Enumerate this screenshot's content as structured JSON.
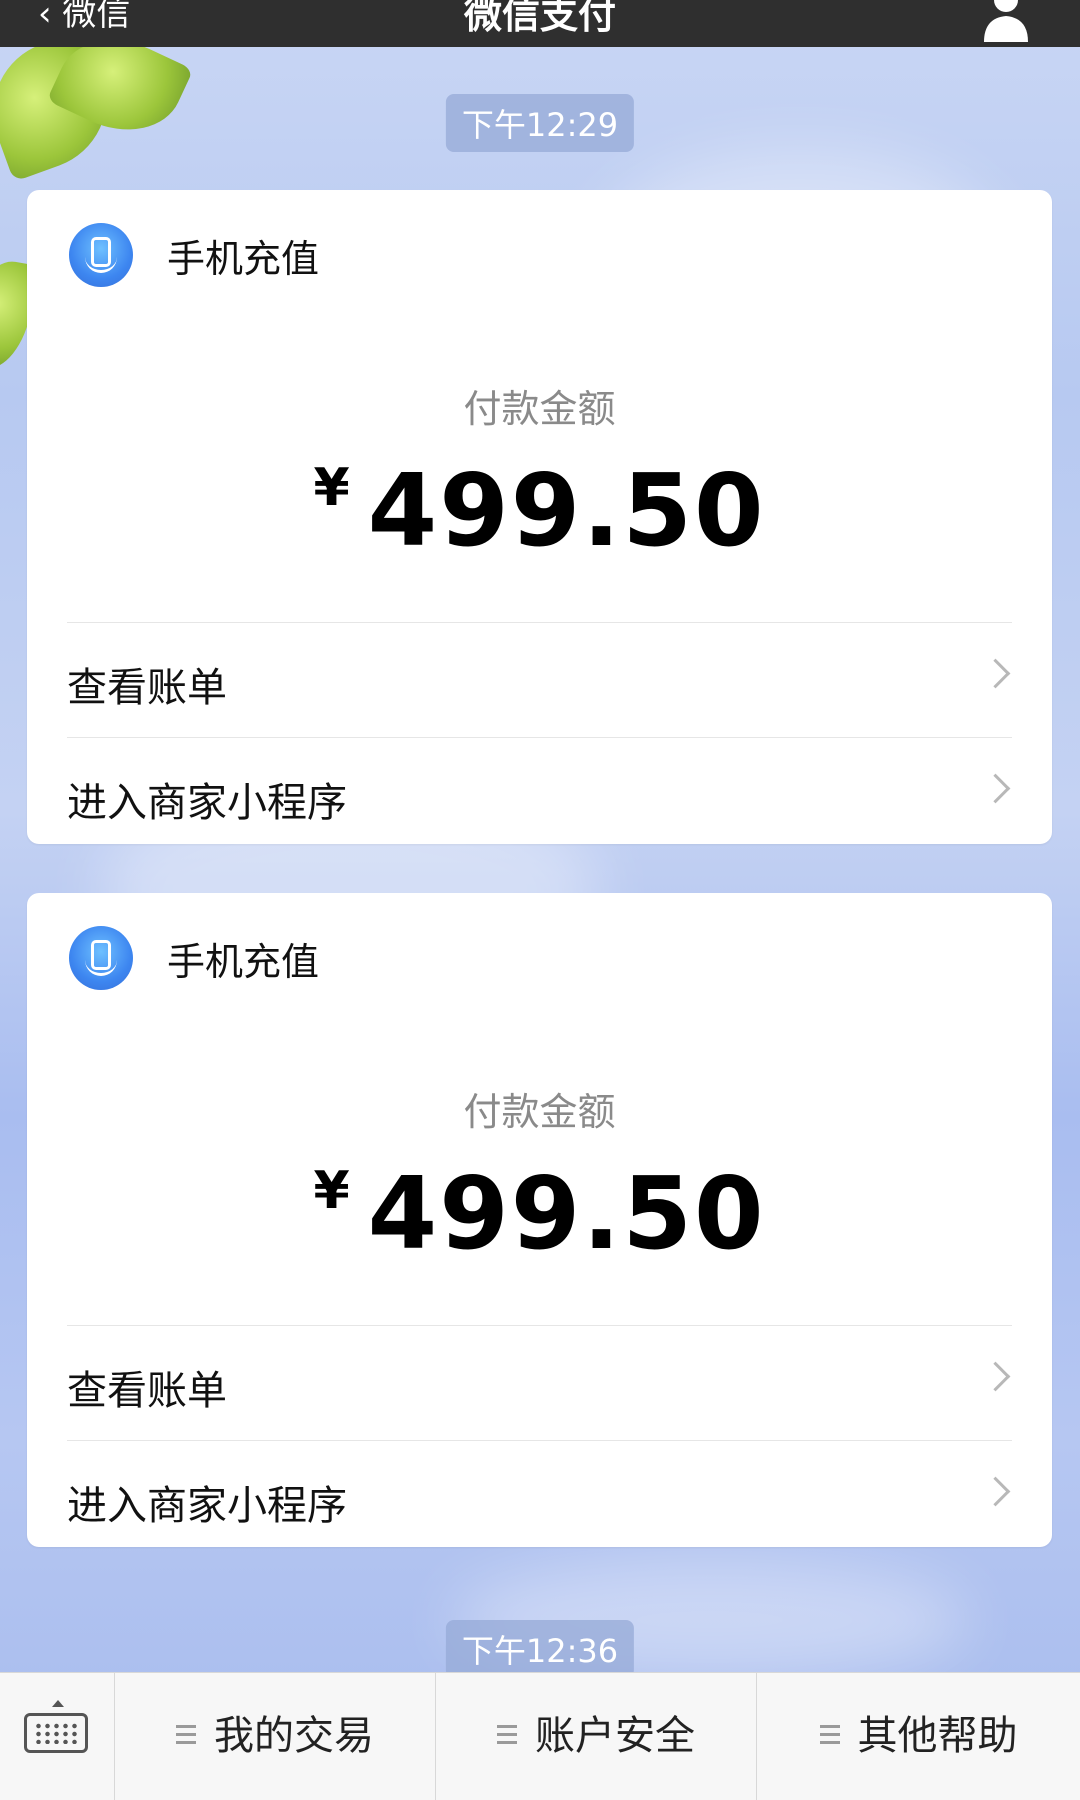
{
  "header": {
    "back_label": "微信",
    "title": "微信支付"
  },
  "timestamps": [
    "下午12:29",
    "下午12:36"
  ],
  "cards": [
    {
      "app_name": "手机充值",
      "amount_label": "付款金额",
      "currency_symbol": "¥",
      "amount": "499.50",
      "actions": [
        {
          "label": "查看账单"
        },
        {
          "label": "进入商家小程序"
        }
      ]
    },
    {
      "app_name": "手机充值",
      "amount_label": "付款金额",
      "currency_symbol": "¥",
      "amount": "499.50",
      "actions": [
        {
          "label": "查看账单"
        },
        {
          "label": "进入商家小程序"
        }
      ]
    }
  ],
  "bottom_menu": {
    "items": [
      {
        "label": "我的交易"
      },
      {
        "label": "账户安全"
      },
      {
        "label": "其他帮助"
      }
    ]
  },
  "icons": {
    "back": "chevron-left-icon",
    "profile": "person-icon",
    "app": "mobile-recharge-icon",
    "row_arrow": "chevron-right-icon",
    "keyboard": "keyboard-icon",
    "menu": "menu-lines-icon"
  },
  "colors": {
    "topbar": "#2f2f2f",
    "accent_icon": "#3d86f0",
    "secondary_text": "#8a8a8a"
  }
}
